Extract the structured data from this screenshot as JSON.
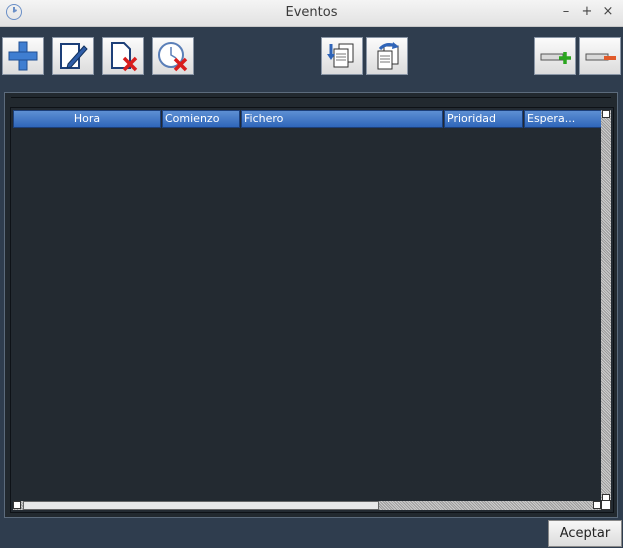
{
  "window": {
    "title": "Eventos",
    "controls": {
      "minimize": "–",
      "maximize": "+",
      "close": "×"
    }
  },
  "toolbar": {
    "buttons": [
      {
        "name": "add-event",
        "icon": "plus-icon"
      },
      {
        "name": "edit-event",
        "icon": "edit-document-icon"
      },
      {
        "name": "delete-event",
        "icon": "delete-document-icon"
      },
      {
        "name": "delete-clock-event",
        "icon": "clock-delete-icon"
      },
      {
        "name": "import",
        "icon": "import-documents-icon"
      },
      {
        "name": "export",
        "icon": "export-documents-icon"
      },
      {
        "name": "add-row",
        "icon": "add-row-icon"
      },
      {
        "name": "remove-row",
        "icon": "remove-row-icon"
      }
    ]
  },
  "table": {
    "columns": [
      "Hora",
      "Comienzo",
      "Fichero",
      "Prioridad",
      "Espera..."
    ],
    "rows": []
  },
  "footer": {
    "accept_label": "Aceptar"
  },
  "colors": {
    "background": "#2f3d4e",
    "table_bg": "#232a31",
    "header_blue": "#3f74c4"
  }
}
